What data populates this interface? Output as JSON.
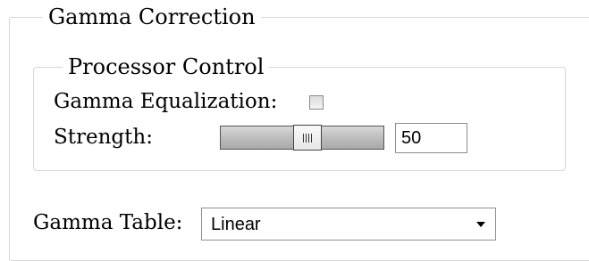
{
  "gamma_correction": {
    "title": "Gamma Correction",
    "processor_control": {
      "title": "Processor Control",
      "gamma_equalization": {
        "label": "Gamma Equalization:",
        "checked": false
      },
      "strength": {
        "label": "Strength:",
        "value": "50",
        "slider_value_fraction": 0.5
      }
    },
    "gamma_table": {
      "label": "Gamma Table:",
      "selected": "Linear",
      "icon": "chevron-down-icon"
    }
  }
}
